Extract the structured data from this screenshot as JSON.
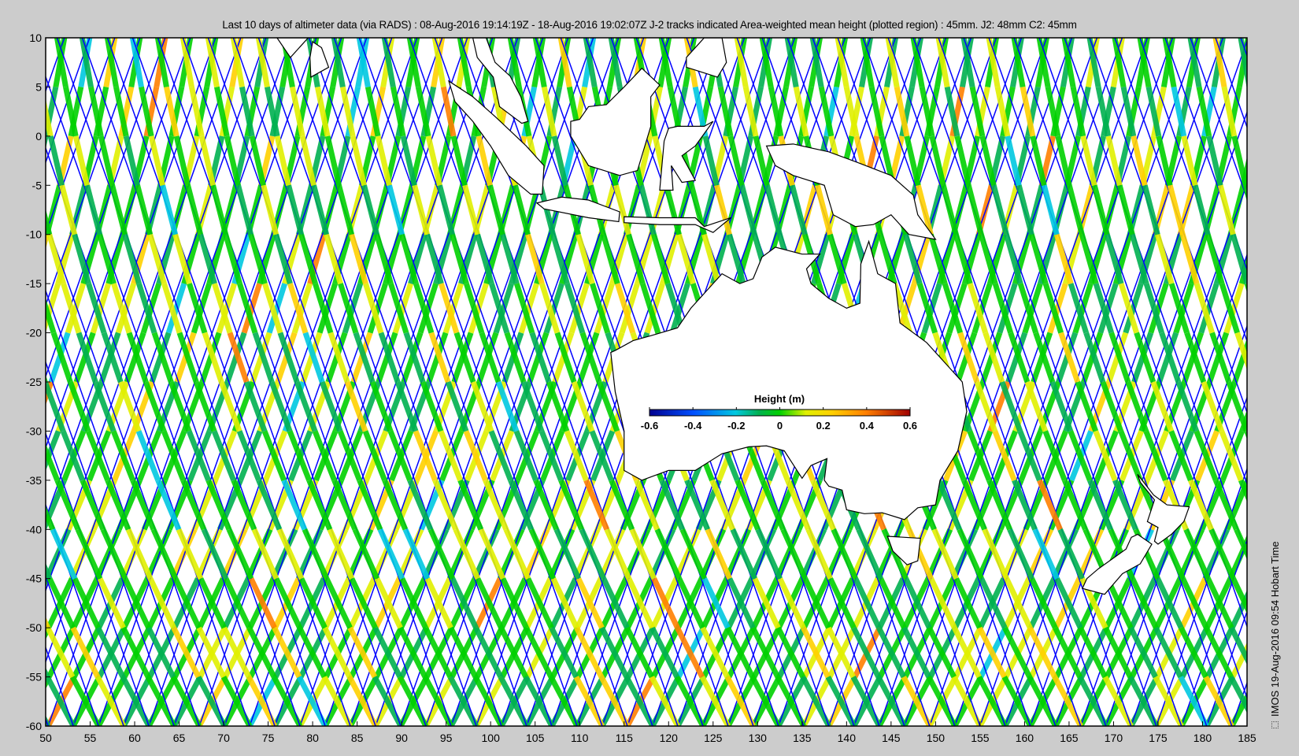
{
  "title": "Last 10 days of altimeter data (via RADS) : 08-Aug-2016 19:14:19Z - 18-Aug-2016 19:02:07Z  J-2 tracks indicated  Area-weighted mean height (plotted region) : 45mm.  J2: 48mm  C2: 45mm",
  "stamp": "IMOS 19-Aug-2016 09:54 Hobart Time",
  "colorbar": {
    "label": "Height (m)",
    "ticks": [
      "-0.6",
      "-0.4",
      "-0.2",
      "0",
      "0.2",
      "0.4",
      "0.6"
    ],
    "range": [
      -0.6,
      0.6
    ]
  },
  "chart_data": {
    "type": "map",
    "xlabel": "",
    "ylabel": "",
    "xlim": [
      50,
      185
    ],
    "ylim": [
      -60,
      10
    ],
    "xticks": [
      "50",
      "55",
      "60",
      "65",
      "70",
      "75",
      "80",
      "85",
      "90",
      "95",
      "100",
      "105",
      "110",
      "115",
      "120",
      "125",
      "130",
      "135",
      "140",
      "145",
      "150",
      "155",
      "160",
      "165",
      "170",
      "175",
      "180",
      "185"
    ],
    "yticks": [
      "10",
      "5",
      "0",
      "-5",
      "-10",
      "-15",
      "-20",
      "-25",
      "-30",
      "-35",
      "-40",
      "-45",
      "-50",
      "-55",
      "-60"
    ],
    "area_weighted_mean_height_mm": 45,
    "j2_mean_mm": 48,
    "c2_mean_mm": 45,
    "colormap": [
      "#00008f",
      "#0050ff",
      "#00c8e0",
      "#00b050",
      "#00d000",
      "#e0f000",
      "#ffd000",
      "#ff8000",
      "#a00000"
    ],
    "track_colors": {
      "j2": "#0000ff",
      "swath": "#22b24a"
    },
    "coastlines": [
      [
        [
          113.5,
          -22
        ],
        [
          114,
          -26
        ],
        [
          115,
          -30
        ],
        [
          115,
          -34
        ],
        [
          117,
          -35
        ],
        [
          120,
          -34
        ],
        [
          123,
          -34
        ],
        [
          126,
          -32.3
        ],
        [
          129,
          -31.6
        ],
        [
          131,
          -31.5
        ],
        [
          133,
          -32
        ],
        [
          135,
          -34.8
        ],
        [
          136,
          -33.5
        ],
        [
          137.8,
          -32.8
        ],
        [
          137.5,
          -35
        ],
        [
          138,
          -35.6
        ],
        [
          139.5,
          -36
        ],
        [
          140,
          -38
        ],
        [
          142,
          -38.4
        ],
        [
          144,
          -38.3
        ],
        [
          146.5,
          -39
        ],
        [
          148,
          -37.8
        ],
        [
          150,
          -37.5
        ],
        [
          150.5,
          -35
        ],
        [
          152.5,
          -32
        ],
        [
          153.5,
          -28
        ],
        [
          153,
          -25
        ],
        [
          151,
          -23
        ],
        [
          149,
          -21
        ],
        [
          146,
          -19
        ],
        [
          145.5,
          -15
        ],
        [
          143.5,
          -14
        ],
        [
          142.5,
          -10.7
        ],
        [
          141.6,
          -13
        ],
        [
          141.5,
          -17
        ],
        [
          140,
          -17.5
        ],
        [
          138,
          -16.5
        ],
        [
          136,
          -15
        ],
        [
          135.5,
          -13.5
        ],
        [
          137,
          -12
        ],
        [
          135,
          -12
        ],
        [
          132,
          -11.3
        ],
        [
          130.5,
          -12.3
        ],
        [
          129.5,
          -14.5
        ],
        [
          128,
          -15
        ],
        [
          126,
          -14
        ],
        [
          124,
          -16
        ],
        [
          122.5,
          -17.5
        ],
        [
          121,
          -19.5
        ],
        [
          118,
          -20.3
        ],
        [
          116,
          -20.8
        ],
        [
          114,
          -21.8
        ]
      ],
      [
        [
          144.6,
          -40.7
        ],
        [
          148.3,
          -40.9
        ],
        [
          148,
          -43.2
        ],
        [
          146.8,
          -43.6
        ],
        [
          145.2,
          -42.2
        ]
      ],
      [
        [
          131,
          -1
        ],
        [
          134,
          -0.8
        ],
        [
          138,
          -1.6
        ],
        [
          141,
          -2.6
        ],
        [
          145,
          -4
        ],
        [
          147.5,
          -6
        ],
        [
          148,
          -8
        ],
        [
          150,
          -10.5
        ],
        [
          147,
          -10
        ],
        [
          145,
          -8
        ],
        [
          143,
          -9
        ],
        [
          141,
          -9.2
        ],
        [
          138.5,
          -8
        ],
        [
          137.5,
          -5
        ],
        [
          134,
          -4
        ],
        [
          132,
          -3
        ]
      ],
      [
        [
          95.3,
          5.6
        ],
        [
          98,
          4
        ],
        [
          100.5,
          2
        ],
        [
          104,
          -1
        ],
        [
          106,
          -3
        ],
        [
          105.8,
          -5.9
        ],
        [
          104.5,
          -5.9
        ],
        [
          102,
          -4
        ],
        [
          100,
          -1
        ],
        [
          98,
          1.5
        ],
        [
          96,
          3.5
        ]
      ],
      [
        [
          105.2,
          -6.8
        ],
        [
          108,
          -6.2
        ],
        [
          111,
          -6.5
        ],
        [
          114.5,
          -7.7
        ],
        [
          114.4,
          -8.7
        ],
        [
          111,
          -8.3
        ],
        [
          106,
          -7.4
        ]
      ],
      [
        [
          109,
          1.5
        ],
        [
          110,
          1.7
        ],
        [
          111,
          3
        ],
        [
          113,
          3.2
        ],
        [
          115,
          5
        ],
        [
          117,
          6.9
        ],
        [
          119,
          5.2
        ],
        [
          118,
          4
        ],
        [
          118,
          1
        ],
        [
          117.5,
          -0.5
        ],
        [
          116.5,
          -3.5
        ],
        [
          114.5,
          -4
        ],
        [
          111,
          -3
        ],
        [
          110,
          -1.5
        ],
        [
          109,
          0
        ]
      ],
      [
        [
          119,
          -5.5
        ],
        [
          120.5,
          -5.5
        ],
        [
          120.3,
          -3
        ],
        [
          121.5,
          -4.7
        ],
        [
          123,
          -4.5
        ],
        [
          121.5,
          -2
        ],
        [
          123,
          -1
        ],
        [
          125,
          1.5
        ],
        [
          124,
          1
        ],
        [
          121,
          1
        ],
        [
          120,
          0.8
        ],
        [
          119.5,
          -0.5
        ]
      ],
      [
        [
          98,
          10
        ],
        [
          98.5,
          8
        ],
        [
          100.3,
          6
        ],
        [
          101,
          3
        ],
        [
          103.5,
          1.3
        ],
        [
          104.2,
          1.5
        ],
        [
          103.4,
          4
        ],
        [
          102.2,
          6.1
        ],
        [
          100.5,
          7.5
        ],
        [
          99.5,
          10
        ]
      ],
      [
        [
          122,
          7
        ],
        [
          125.5,
          6
        ],
        [
          126.5,
          7.5
        ],
        [
          126,
          10
        ],
        [
          124,
          10
        ],
        [
          122,
          8
        ]
      ],
      [
        [
          79.8,
          6
        ],
        [
          81.8,
          7
        ],
        [
          81,
          9
        ],
        [
          80,
          9.6
        ],
        [
          79.7,
          8
        ]
      ],
      [
        [
          76,
          10
        ],
        [
          77.5,
          8
        ],
        [
          78.5,
          9
        ],
        [
          79.5,
          10
        ]
      ],
      [
        [
          115,
          -8.2
        ],
        [
          119,
          -8.3
        ],
        [
          123,
          -8.3
        ],
        [
          124,
          -9.2
        ],
        [
          127,
          -8.3
        ],
        [
          125,
          -9.8
        ],
        [
          123,
          -9
        ],
        [
          119,
          -9
        ],
        [
          115,
          -8.8
        ]
      ],
      [
        [
          172.7,
          -34.4
        ],
        [
          174.5,
          -36.5
        ],
        [
          176,
          -37.5
        ],
        [
          178.5,
          -37.7
        ],
        [
          177.9,
          -39.2
        ],
        [
          176.5,
          -40.5
        ],
        [
          175,
          -41.5
        ],
        [
          174.6,
          -41.2
        ],
        [
          175,
          -39.8
        ],
        [
          173.8,
          -39.2
        ],
        [
          174.6,
          -37
        ],
        [
          173,
          -35.2
        ]
      ],
      [
        [
          172.7,
          -40.5
        ],
        [
          174.3,
          -41.5
        ],
        [
          173,
          -43.5
        ],
        [
          171,
          -44.5
        ],
        [
          169,
          -46.6
        ],
        [
          166.5,
          -46
        ],
        [
          167,
          -45
        ],
        [
          168.3,
          -44
        ],
        [
          171.4,
          -42
        ],
        [
          172,
          -40.8
        ]
      ]
    ]
  }
}
